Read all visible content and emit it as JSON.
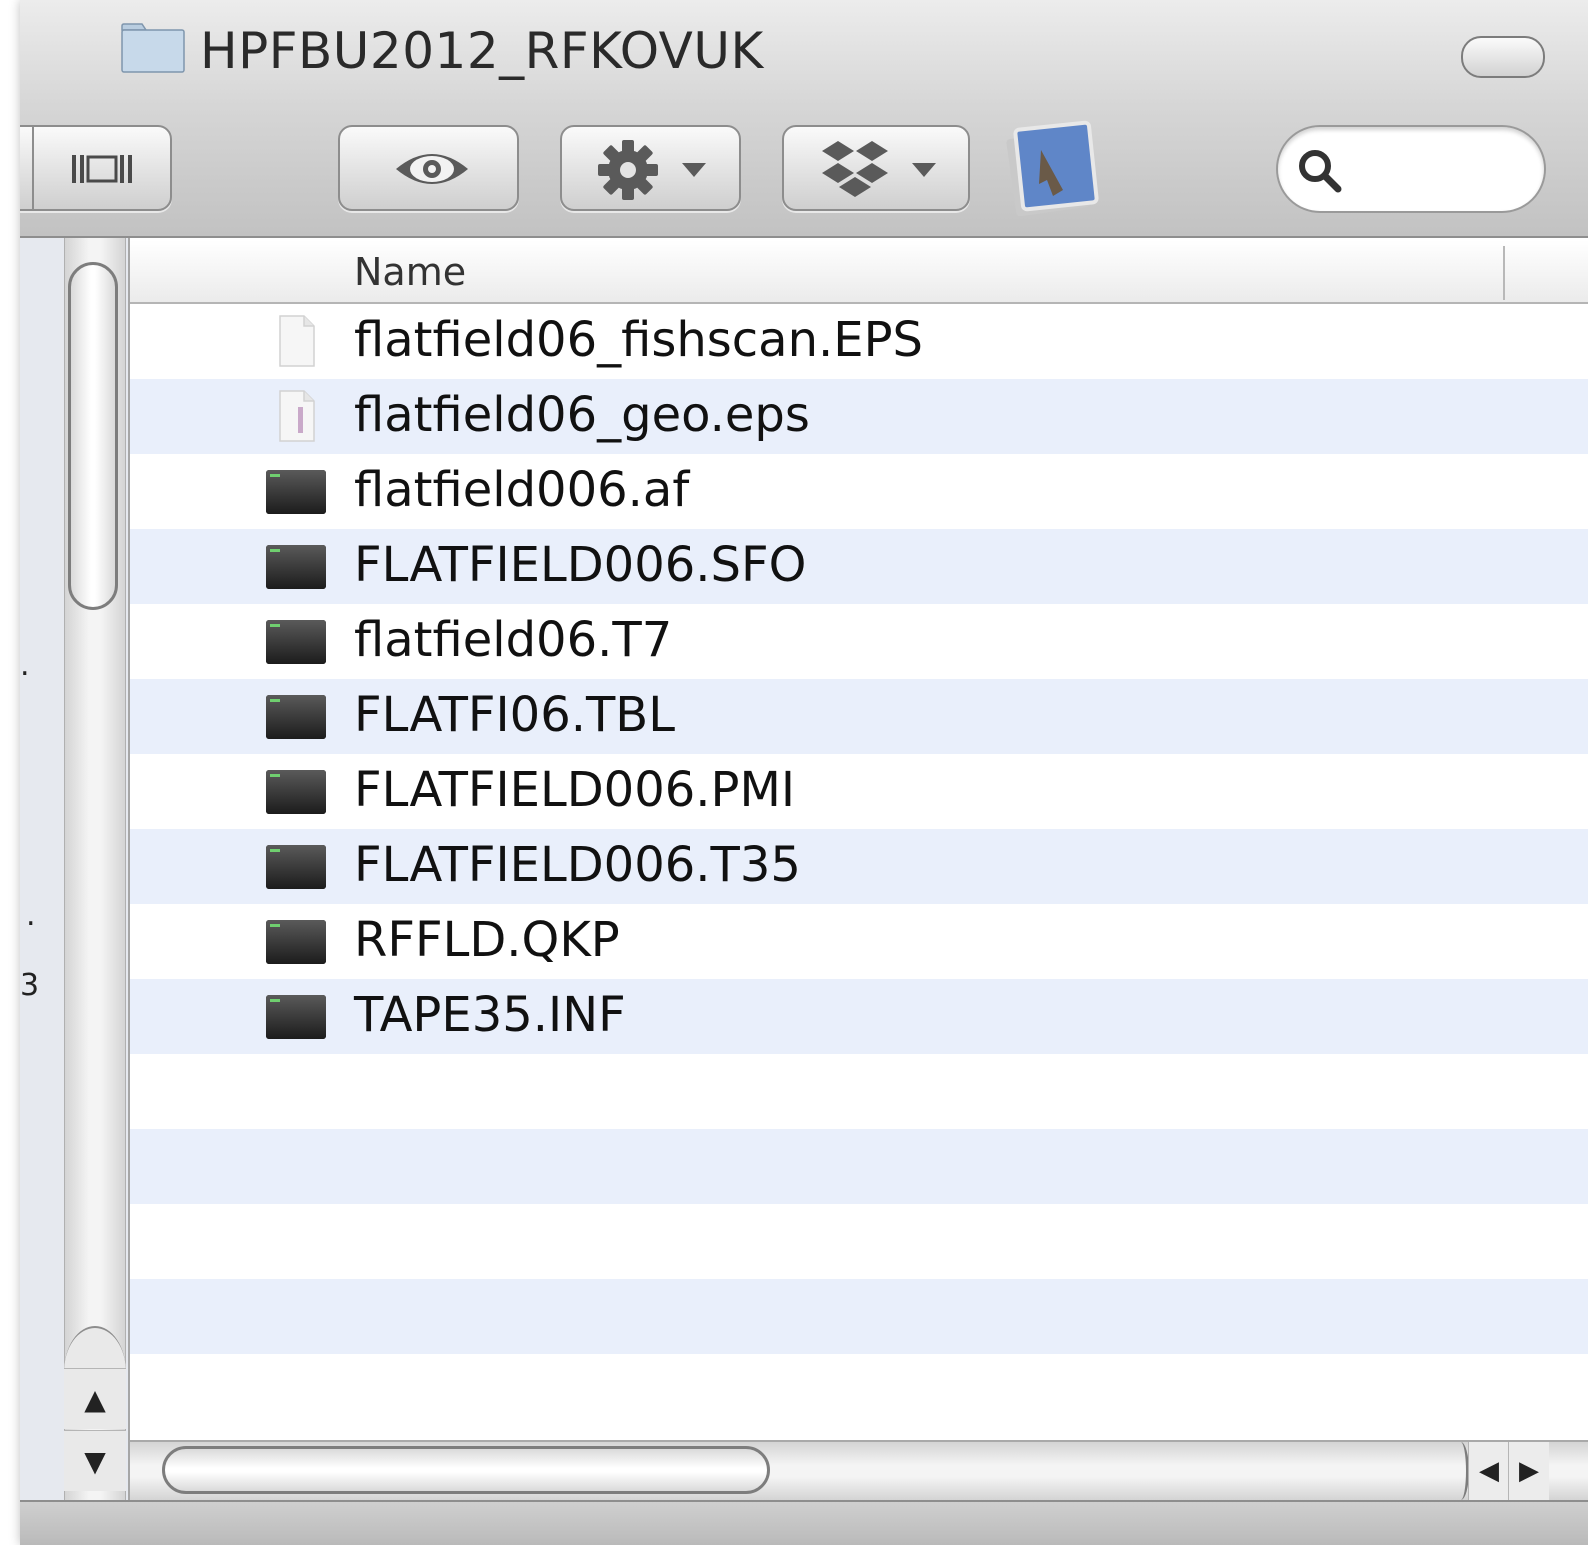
{
  "window": {
    "title": "HPFBU2012_RFKOVUK"
  },
  "search": {
    "placeholder": ""
  },
  "list": {
    "column_name": "Name",
    "files": [
      {
        "name": "flatfield06_fishscan.EPS",
        "icon": "document-blank-icon"
      },
      {
        "name": "flatfield06_geo.eps",
        "icon": "eps-document-icon"
      },
      {
        "name": "flatfield006.af",
        "icon": "terminal-exec-icon"
      },
      {
        "name": "FLATFIELD006.SFO",
        "icon": "terminal-exec-icon"
      },
      {
        "name": "flatfield06.T7",
        "icon": "terminal-exec-icon"
      },
      {
        "name": "FLATFI06.TBL",
        "icon": "terminal-exec-icon"
      },
      {
        "name": "FLATFIELD006.PMI",
        "icon": "terminal-exec-icon"
      },
      {
        "name": "FLATFIELD006.T35",
        "icon": "terminal-exec-icon"
      },
      {
        "name": "RFFLD.QKP",
        "icon": "terminal-exec-icon"
      },
      {
        "name": "TAPE35.INF",
        "icon": "terminal-exec-icon"
      }
    ]
  },
  "sidebar": {
    "fragments": [
      ".",
      ".",
      "3"
    ]
  },
  "colors": {
    "row_alt": "#e9effb",
    "header_bg": "#d6d6d6"
  }
}
